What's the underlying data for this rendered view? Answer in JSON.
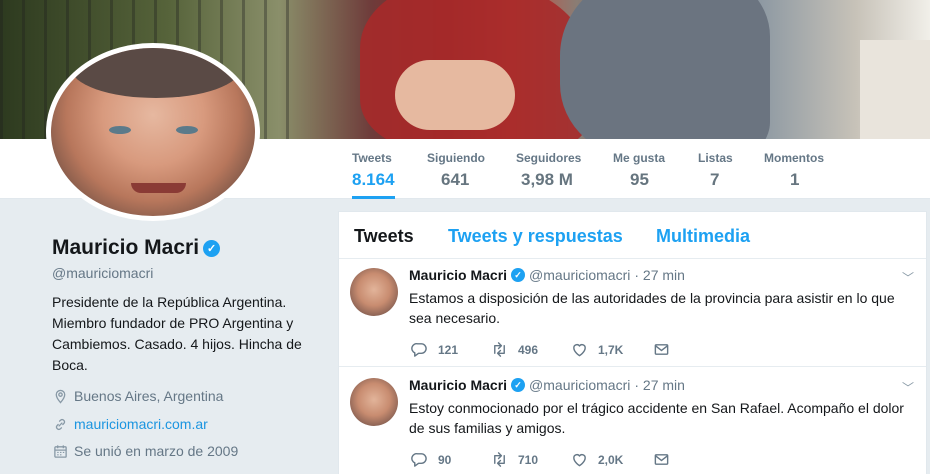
{
  "profile": {
    "name": "Mauricio Macri",
    "handle": "@mauriciomacri",
    "bio": "Presidente de la República Argentina. Miembro fundador de PRO Argentina y Cambiemos. Casado. 4 hijos. Hincha de Boca.",
    "location": "Buenos Aires, Argentina",
    "website": "mauriciomacri.com.ar",
    "joined": "Se unió en marzo de 2009"
  },
  "stats": [
    {
      "label": "Tweets",
      "value": "8.164"
    },
    {
      "label": "Siguiendo",
      "value": "641"
    },
    {
      "label": "Seguidores",
      "value": "3,98 M"
    },
    {
      "label": "Me gusta",
      "value": "95"
    },
    {
      "label": "Listas",
      "value": "7"
    },
    {
      "label": "Momentos",
      "value": "1"
    }
  ],
  "tabs": [
    "Tweets",
    "Tweets y respuestas",
    "Multimedia"
  ],
  "tweets": [
    {
      "name": "Mauricio Macri",
      "handle": "@mauriciomacri",
      "time": "· 27 min",
      "text": "Estamos a disposición de las autoridades de la provincia para asistir en lo que sea necesario.",
      "replies": "121",
      "retweets": "496",
      "likes": "1,7K"
    },
    {
      "name": "Mauricio Macri",
      "handle": "@mauriciomacri",
      "time": "· 27 min",
      "text": "Estoy conmocionado por el trágico accidente en San Rafael. Acompaño el dolor de sus familias y amigos.",
      "replies": "90",
      "retweets": "710",
      "likes": "2,0K"
    }
  ],
  "colors": {
    "accent": "#1da1f2",
    "background": "#e6ecf0",
    "link": "#1b95e0"
  },
  "icons": {
    "verified": "verified-badge-icon",
    "location": "location-pin-icon",
    "link": "link-icon",
    "calendar": "calendar-icon"
  }
}
